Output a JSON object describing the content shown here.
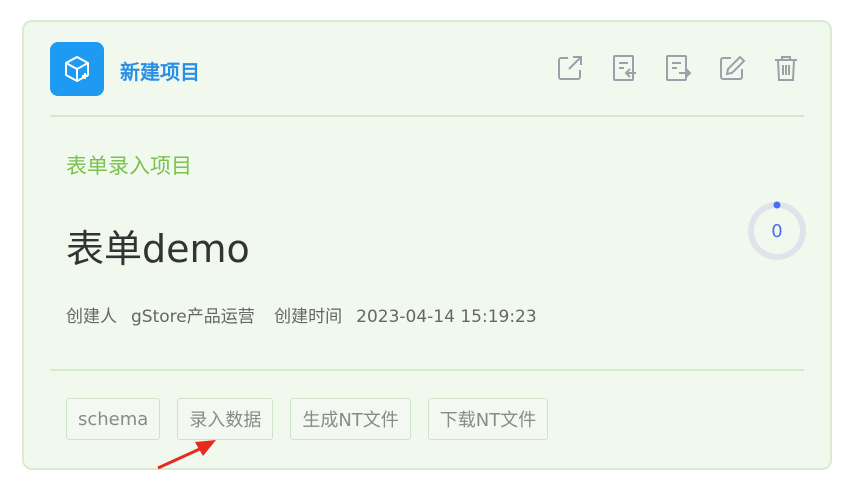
{
  "card": {
    "header_title": "新建项目",
    "type_label": "表单录入项目",
    "title": "表单demo",
    "creator_label": "创建人",
    "creator": "gStore产品运营",
    "created_label": "创建时间",
    "created_at": "2023-04-14 15:19:23",
    "count": "0"
  },
  "header_actions": [
    "share-icon",
    "import-icon",
    "export-icon",
    "edit-icon",
    "delete-icon"
  ],
  "buttons": [
    "schema",
    "录入数据",
    "生成NT文件",
    "下载NT文件"
  ],
  "colors": {
    "card_bg": "#f1f9ef",
    "logo_bg": "#1e9af2",
    "link": "#2b8fe4",
    "type_label": "#7bc14e",
    "ring_value": "#4a6ef0",
    "arrow": "#e8291c"
  }
}
